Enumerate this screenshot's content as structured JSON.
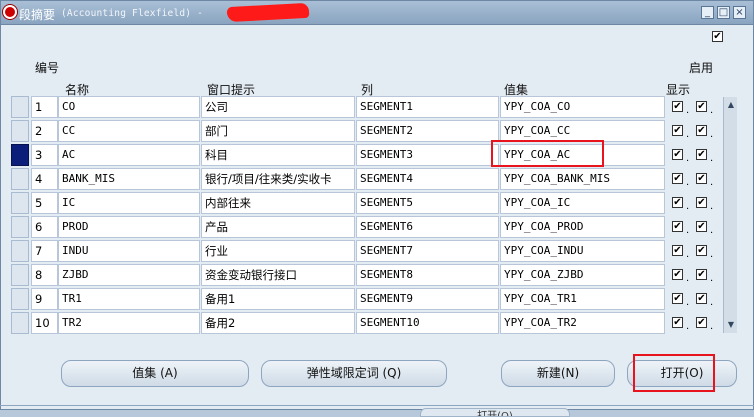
{
  "window": {
    "title_prefix": "段摘要",
    "title_text": "(Accounting Flexfield) -",
    "controls": {
      "minimize": "_",
      "maximize": "□",
      "close": "×"
    }
  },
  "top_checkbox": {
    "checked": true
  },
  "headers": {
    "number": "编号",
    "name": "名称",
    "prompt": "窗口提示",
    "column": "列",
    "value_set": "值集",
    "enabled": "启用",
    "displayed": "显示"
  },
  "rows": [
    {
      "no": "1",
      "name": "CO",
      "prompt": "公司",
      "column": "SEGMENT1",
      "value_set": "YPY_COA_CO",
      "displayed": true,
      "enabled": true
    },
    {
      "no": "2",
      "name": "CC",
      "prompt": "部门",
      "column": "SEGMENT2",
      "value_set": "YPY_COA_CC",
      "displayed": true,
      "enabled": true
    },
    {
      "no": "3",
      "name": "AC",
      "prompt": "科目",
      "column": "SEGMENT3",
      "value_set": "YPY_COA_AC",
      "displayed": true,
      "enabled": true
    },
    {
      "no": "4",
      "name": "BANK_MIS",
      "prompt": "银行/项目/往来类/实收卡",
      "column": "SEGMENT4",
      "value_set": "YPY_COA_BANK_MIS",
      "displayed": true,
      "enabled": true
    },
    {
      "no": "5",
      "name": "IC",
      "prompt": "内部往来",
      "column": "SEGMENT5",
      "value_set": "YPY_COA_IC",
      "displayed": true,
      "enabled": true
    },
    {
      "no": "6",
      "name": "PROD",
      "prompt": "产品",
      "column": "SEGMENT6",
      "value_set": "YPY_COA_PROD",
      "displayed": true,
      "enabled": true
    },
    {
      "no": "7",
      "name": "INDU",
      "prompt": "行业",
      "column": "SEGMENT7",
      "value_set": "YPY_COA_INDU",
      "displayed": true,
      "enabled": true
    },
    {
      "no": "8",
      "name": "ZJBD",
      "prompt": "资金变动银行接口",
      "column": "SEGMENT8",
      "value_set": "YPY_COA_ZJBD",
      "displayed": true,
      "enabled": true
    },
    {
      "no": "9",
      "name": "TR1",
      "prompt": "备用1",
      "column": "SEGMENT9",
      "value_set": "YPY_COA_TR1",
      "displayed": true,
      "enabled": true
    },
    {
      "no": "10",
      "name": "TR2",
      "prompt": "备用2",
      "column": "SEGMENT10",
      "value_set": "YPY_COA_TR2",
      "displayed": true,
      "enabled": true
    }
  ],
  "current_row": 3,
  "check_mark": "✔",
  "buttons": {
    "value_set": "值集 (A)",
    "flex_qualifiers": "弹性域限定词 (Q)",
    "new": "新建(N)",
    "open": "打开(O)"
  },
  "bottom_tab": "打开(O)",
  "colors": {
    "highlight": "#e8141d",
    "current_row": "#0a1e7a",
    "title_bar": "#8aa4c0"
  }
}
